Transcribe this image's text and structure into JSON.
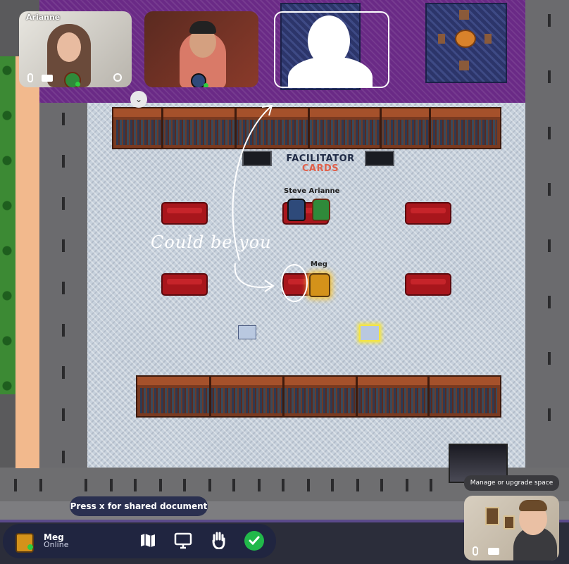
{
  "video_tiles": [
    {
      "name": "Arianne",
      "icons": [
        "mic-icon",
        "video-icon",
        "avatar",
        "no-entry-icon"
      ]
    },
    {
      "name": "",
      "icons": [
        "avatar"
      ]
    },
    {
      "name": "",
      "icons": []
    }
  ],
  "map": {
    "sign_line1": "FACILITATOR",
    "sign_line2": "CARDS",
    "characters": [
      {
        "label": "Steve Arianne"
      },
      {
        "label": "Meg"
      }
    ],
    "annotation": "Could be you"
  },
  "tooltips": {
    "shared_document": "Press x for shared document",
    "manage_space": "Manage or upgrade space"
  },
  "user": {
    "name": "Meg",
    "status": "Online"
  },
  "toolbar": {
    "icons": [
      "map-icon",
      "screen-share-icon",
      "raise-hand-icon",
      "check-icon"
    ]
  },
  "colors": {
    "status_online": "#2ecc40",
    "check_button": "#21b84a",
    "carpet_purple": "#6a2a86",
    "floor": "#c7d1dc"
  }
}
